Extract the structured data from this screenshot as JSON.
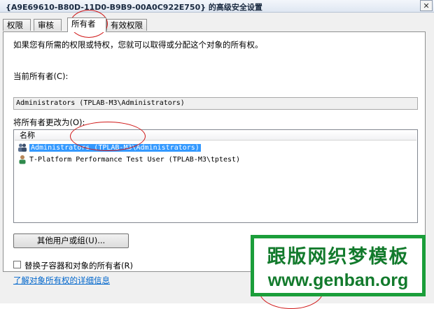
{
  "window": {
    "title": "{A9E69610-B80D-11D0-B9B9-00A0C922E750} 的高级安全设置",
    "close_glyph": "✕"
  },
  "tabs": [
    {
      "label": "权限",
      "active": false
    },
    {
      "label": "审核",
      "active": false
    },
    {
      "label": "所有者",
      "active": true
    },
    {
      "label": "有效权限",
      "active": false
    }
  ],
  "owner_page": {
    "intro": "如果您有所需的权限或特权，您就可以取得或分配这个对象的所有权。",
    "current_owner_label": "当前所有者(C):",
    "current_owner_value": "Administrators (TPLAB-M3\\Administrators)",
    "change_to_label": "将所有者更改为(O):",
    "list_header": "名称",
    "list_items": [
      {
        "name": "Administrators (TPLAB-M3\\Administrators)",
        "icon": "group-icon",
        "selected": true
      },
      {
        "name": "T-Platform Performance Test User (TPLAB-M3\\tptest)",
        "icon": "user-icon",
        "selected": false
      }
    ],
    "other_users_button": "其他用户或组(U)...",
    "replace_checkbox_label": "替换子容器和对象的所有者(R)",
    "replace_checked": false,
    "learn_more_link": "了解对象所有权的详细信息"
  },
  "watermark": {
    "line1": "跟版网织梦模板",
    "line2": "www.genban.org",
    "color": "#127a2c"
  }
}
